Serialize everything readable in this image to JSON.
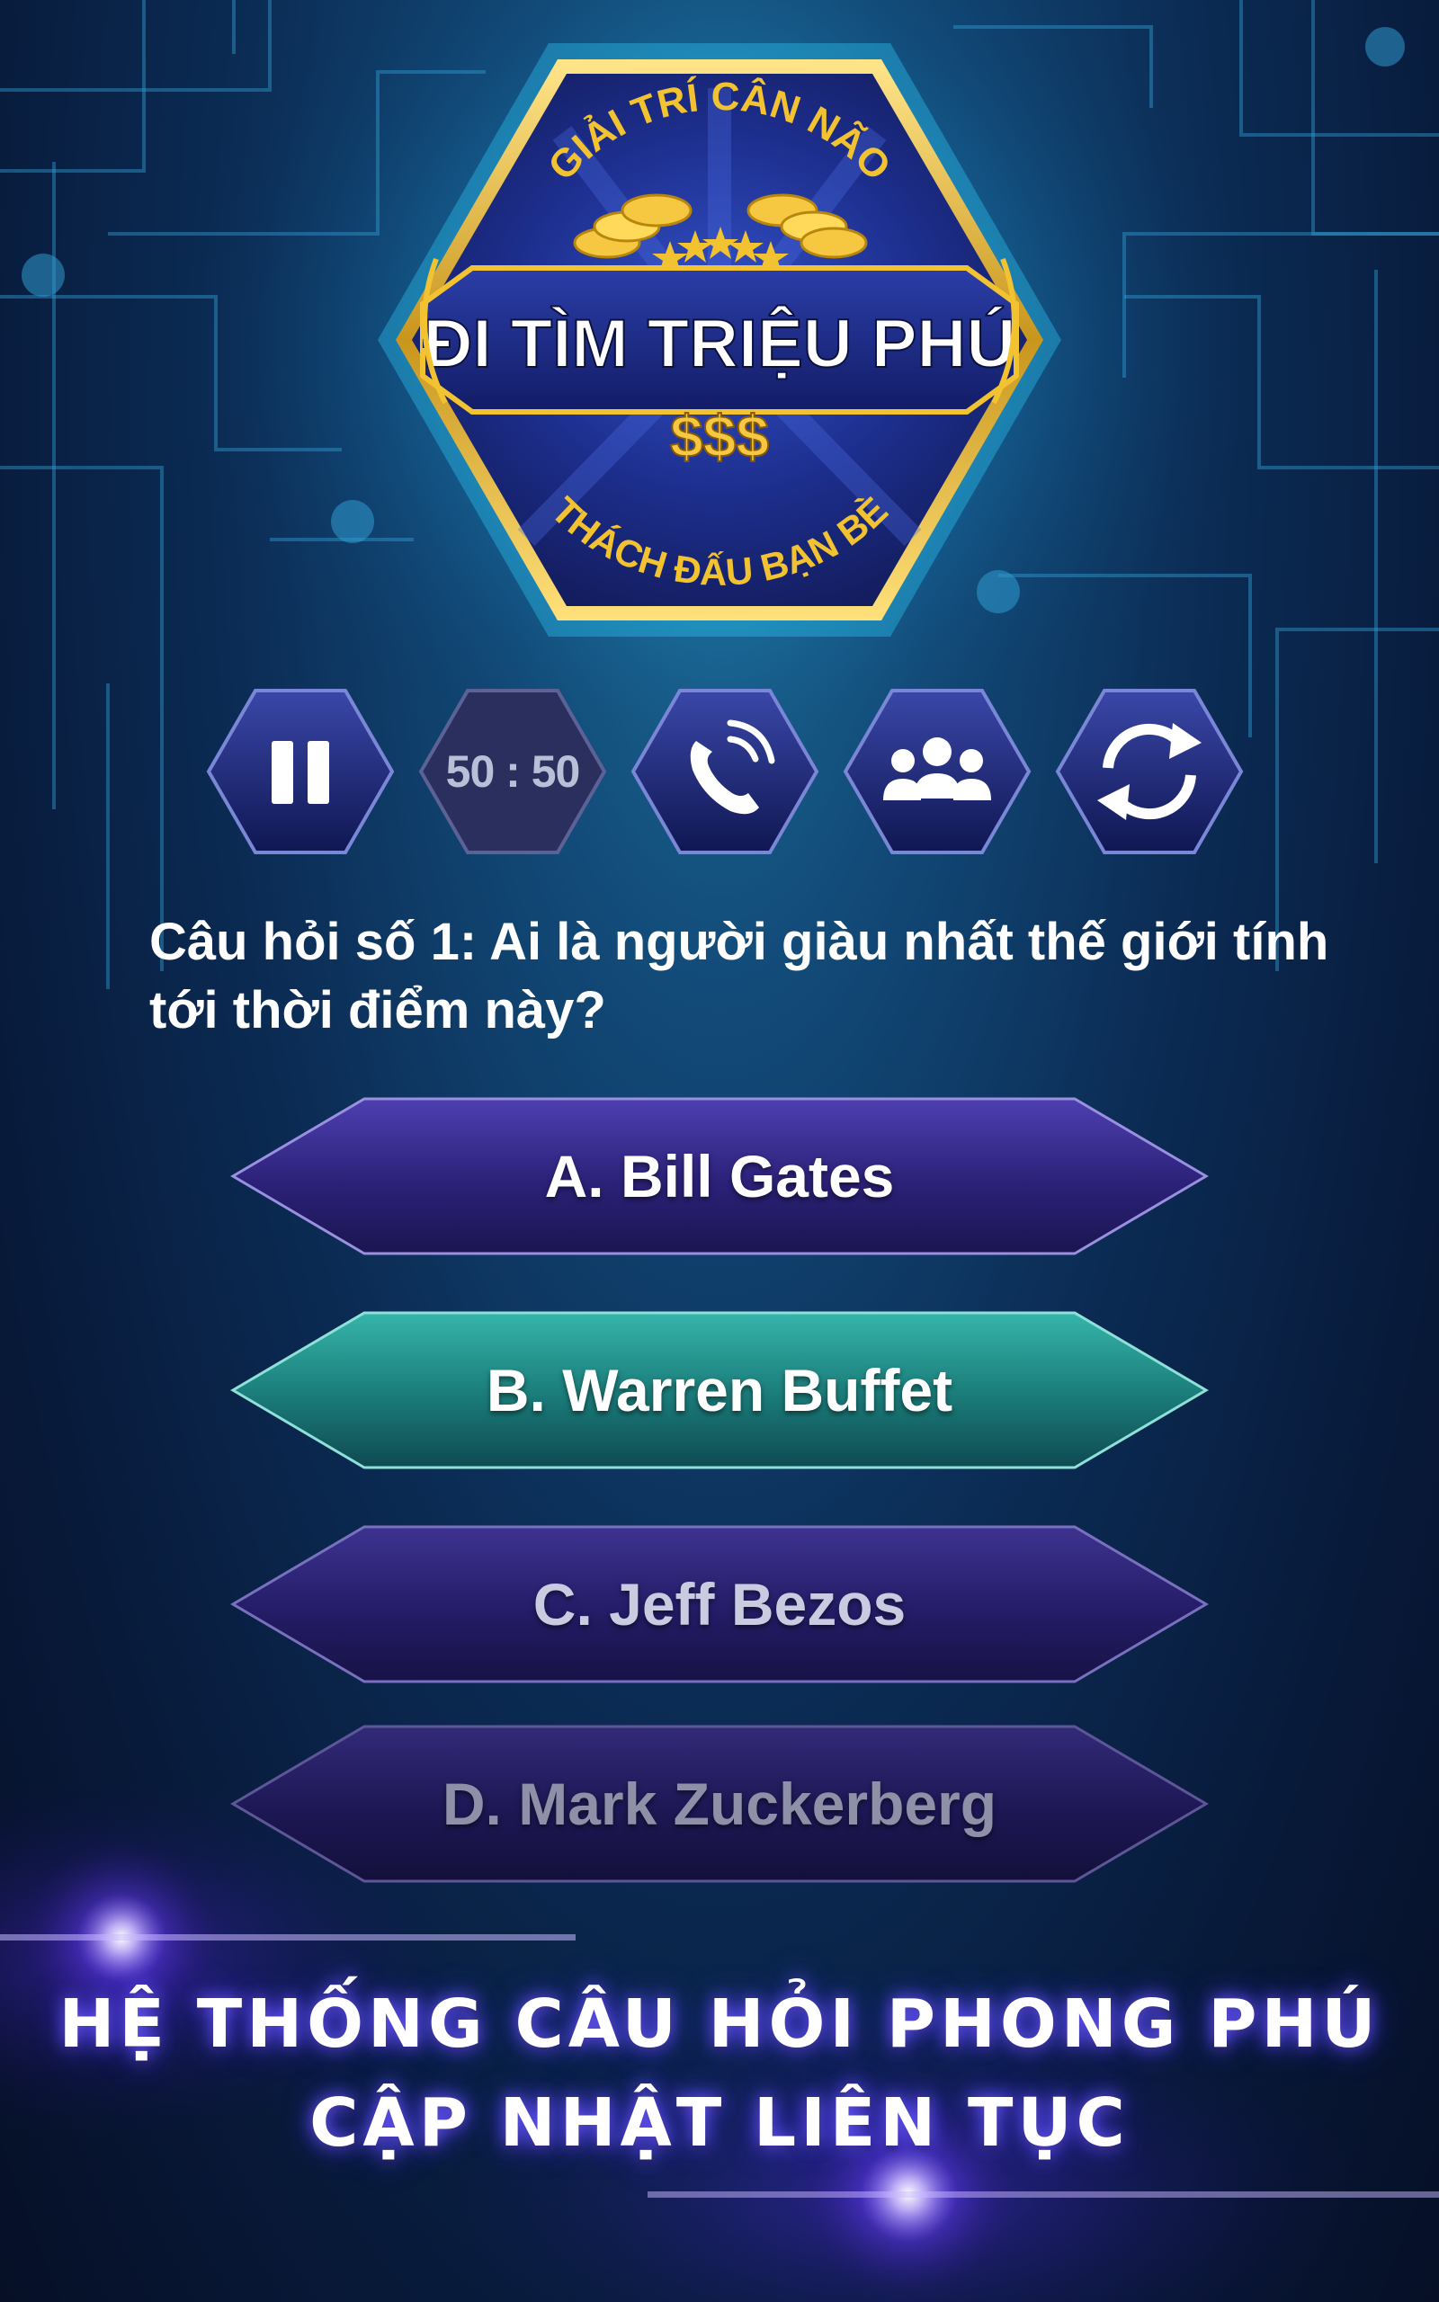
{
  "logo": {
    "arc_top": "GIẢI TRÍ CÂN NÃO",
    "title": "ĐI TÌM TRIỆU PHÚ",
    "currency": "$$$",
    "arc_bottom": "THÁCH ĐẤU BẠN BÈ"
  },
  "lifelines": [
    {
      "name": "pause",
      "icon": "pause-icon"
    },
    {
      "name": "fifty-fifty",
      "label": "50 : 50"
    },
    {
      "name": "call-friend",
      "icon": "phone-icon"
    },
    {
      "name": "ask-audience",
      "icon": "audience-icon"
    },
    {
      "name": "switch-question",
      "icon": "refresh-icon"
    }
  ],
  "question": {
    "text": "Câu hỏi số 1: Ai là người giàu nhất thế giới tính tới thời điểm này?"
  },
  "answers": [
    {
      "label": "A. Bill Gates",
      "state": "normal"
    },
    {
      "label": "B. Warren Buffet",
      "state": "selected"
    },
    {
      "label": "C. Jeff Bezos",
      "state": "dimmed"
    },
    {
      "label": "D. Mark Zuckerberg",
      "state": "dimmed"
    }
  ],
  "footer": {
    "line1": "HỆ THỐNG CÂU HỎI PHONG PHÚ",
    "line2": "CẬP NHẬT LIÊN TỤC"
  },
  "colors": {
    "accent_gold": "#f2c230",
    "logo_navy": "#1b2a7a",
    "selected_teal": "#1f8f8c",
    "answer_purple": "#3b2f8e",
    "glow_violet": "#7b5bff"
  }
}
